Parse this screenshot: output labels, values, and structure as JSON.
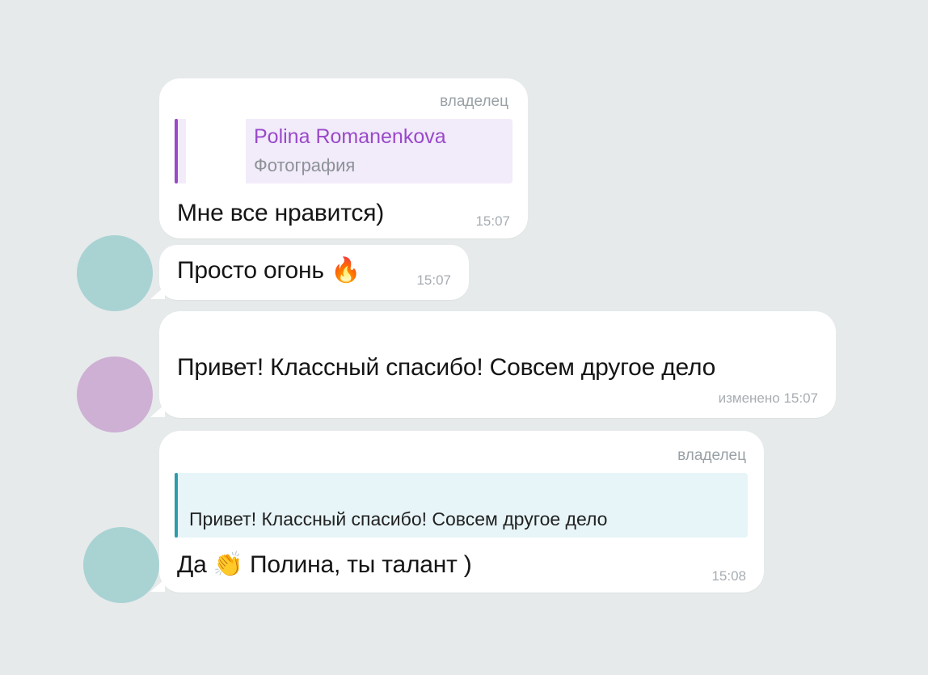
{
  "colors": {
    "background": "#e6eaeb",
    "avatar_teal": "#a9d2d3",
    "avatar_lilac": "#cdb0d3",
    "reply_purple": "#9a49c9",
    "reply_purple_bg": "#f1ebfa",
    "reply_teal": "#2c9cb0",
    "reply_teal_bg": "#e7f5f8"
  },
  "messages": [
    {
      "role": "владелец",
      "reply": {
        "name": "Polina Romanenkova",
        "subtitle": "Фотография"
      },
      "text": "Мне все нравится)",
      "time": "15:07"
    },
    {
      "text": "Просто огонь",
      "emoji": "🔥",
      "emoji_icon": "fire-emoji-icon",
      "time": "15:07"
    },
    {
      "text": "Привет! Классный спасибо! Совсем другое дело",
      "time": "изменено 15:07"
    },
    {
      "role": "владелец",
      "reply": {
        "text": "Привет! Классный спасибо! Совсем другое дело"
      },
      "text_before": "Да",
      "emoji": "👏",
      "emoji_icon": "clapping-hands-emoji-icon",
      "text_after": "Полина, ты талант )",
      "time": "15:08"
    }
  ]
}
